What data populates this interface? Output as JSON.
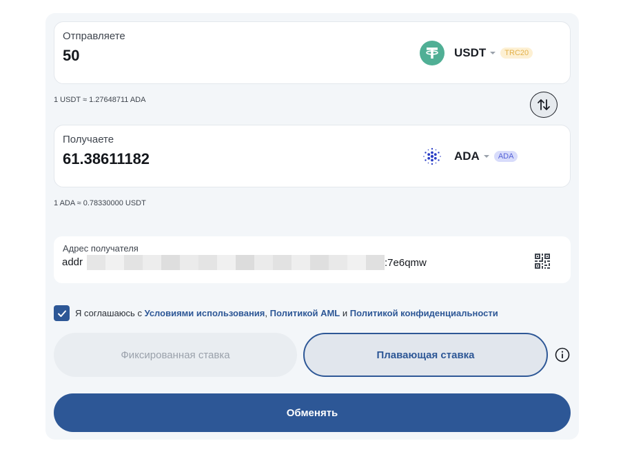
{
  "send": {
    "label": "Отправляете",
    "amount": "50",
    "coin": "USDT",
    "coin_icon": "tether-icon",
    "network": "TRC20",
    "coin_color": "#50af95"
  },
  "send_rate": "1 USDT ≈ 1.27648711 ADA",
  "receive": {
    "label": "Получаете",
    "amount": "61.38611182",
    "coin": "ADA",
    "coin_icon": "cardano-icon",
    "network": "ADA",
    "coin_color": "#2a3ec5"
  },
  "receive_rate": "1 ADA ≈ 0.78330000 USDT",
  "recipient": {
    "label": "Адрес получателя",
    "address_prefix": "addr",
    "address_suffix": ":7e6qmw"
  },
  "agreement": {
    "prefix": "Я соглашаюсь с ",
    "terms_link": "Условиями использования",
    "comma": ", ",
    "aml_link": "Политикой AML",
    "and": " и ",
    "privacy_link": "Политикой конфиденциальности",
    "checked": true
  },
  "rate_type": {
    "fixed_label": "Фиксированная ставка",
    "float_label": "Плавающая ставка",
    "selected": "float"
  },
  "exchange_button": "Обменять",
  "colors": {
    "accent": "#2d5796",
    "panel_bg": "#f3f6f9"
  }
}
